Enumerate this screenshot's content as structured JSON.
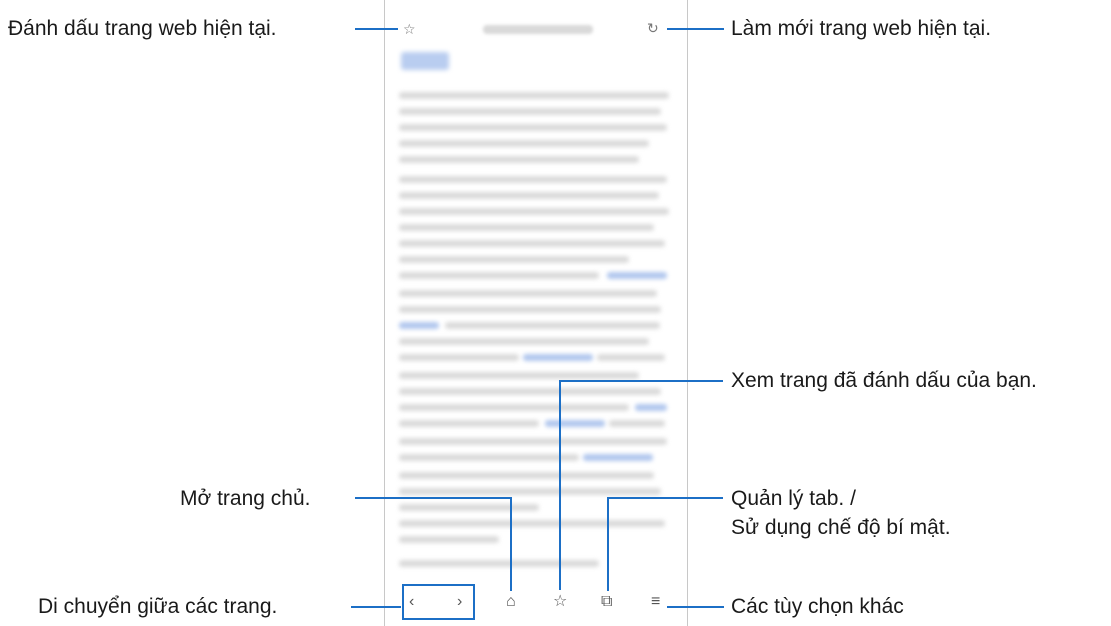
{
  "callouts": {
    "bookmark_page": "Đánh dấu trang web hiện tại.",
    "refresh_page": "Làm mới trang web hiện tại.",
    "view_bookmarks": "Xem trang đã đánh dấu của bạn.",
    "home": "Mở trang chủ.",
    "tabs_line1": "Quản lý tab. /",
    "tabs_line2": "Sử dụng chế độ bí mật.",
    "navigate": "Di chuyển giữa các trang.",
    "more_options": "Các tùy chọn khác"
  },
  "icons": {
    "bookmark_star": "☆",
    "refresh": "↻",
    "back": "‹",
    "forward": "›",
    "home": "⌂",
    "bookmarks": "☆",
    "tabs": "⧉",
    "menu": "≡"
  },
  "colors": {
    "accent": "#1c6fc6"
  }
}
